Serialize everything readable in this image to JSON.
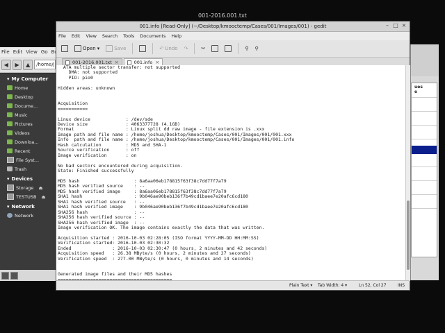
{
  "bg_window_title": "001-2016.001.txt",
  "file_manager": {
    "menu": [
      "File",
      "Edit",
      "View",
      "Go",
      "Book"
    ],
    "path_text": "/home/j",
    "sections": [
      {
        "title": "My Computer",
        "items": [
          {
            "label": "Home",
            "icon": "folder-icon"
          },
          {
            "label": "Desktop",
            "icon": "folder-icon"
          },
          {
            "label": "Docume...",
            "icon": "folder-icon"
          },
          {
            "label": "Music",
            "icon": "folder-icon"
          },
          {
            "label": "Pictures",
            "icon": "folder-icon"
          },
          {
            "label": "Videos",
            "icon": "folder-icon"
          },
          {
            "label": "Downloa...",
            "icon": "folder-icon"
          },
          {
            "label": "Recent",
            "icon": "folder-icon"
          },
          {
            "label": "File Syst...",
            "icon": "drive-icon"
          },
          {
            "label": "Trash",
            "icon": "trash-icon"
          }
        ]
      },
      {
        "title": "Devices",
        "items": [
          {
            "label": "Storage",
            "icon": "drive-icon"
          },
          {
            "label": "TESTUSB",
            "icon": "drive-icon"
          }
        ]
      },
      {
        "title": "Network",
        "items": [
          {
            "label": "Network",
            "icon": "network-icon"
          }
        ]
      }
    ]
  },
  "right_window": {
    "caption": "ues\ne"
  },
  "gedit": {
    "title": "001.info [Read-Only] (~/Desktop/kmooctemp/Cases/001/Images/001) - gedit",
    "menu": [
      "File",
      "Edit",
      "View",
      "Search",
      "Tools",
      "Documents",
      "Help"
    ],
    "toolbar": {
      "new": "",
      "open": "Open",
      "save": "Save",
      "print": "",
      "undo": "Undo",
      "redo": "",
      "cut": "",
      "copy": "",
      "paste": "",
      "find": "",
      "replace": ""
    },
    "tabs": [
      {
        "label": "001-2016.001.txt"
      },
      {
        "label": "001.info"
      }
    ],
    "content": "  ATA multiple sector transfer: not supported\n    DMA: not supported\n    PIO: pio0\n\nHidden areas: unknown\n\n\nAcquisition\n===========\n\nLinux device             : /dev/sde\nDevice size              : 4063377728 (4.1GB)\nFormat                   : Linux split dd raw image - file extension is .xxx\nImage path and file name : /home/joshua/Desktop/kmooctemp/Cases/001/Images/001/001.xxx\nInfo  path and file name : /home/joshua/Desktop/kmooctemp/Cases/001/Images/001/001.info\nHash calculation         : MD5 and SHA-1\nSource verification      : off\nImage verification       : on\n\nNo bad sectors encountered during acquisition.\nState: Finished successfully\n\nMD5 hash                    : 8a6aa06eb178815f63f38c7dd77f7a79\nMD5 hash verified source    : --\nMD5 hash verified image     : 8a6aa06eb178815f63f38c7dd77f7a79\nSHA1 hash                   : 9b046ae90beb136f7b49cd1baee7e20afc6cd180\nSHA1 hash verified source   : --\nSHA1 hash verified image    : 9b046ae90beb136f7b49cd1baee7e20afc6cd180\nSHA256 hash                 : --\nSHA256 hash verified source : --\nSHA256 hash verified image  : --\nImage verification OK. The image contains exactly the data that was written.\n\nAcquisition started : 2016-10-03 02:28:05 (ISO format YYYY-MM-DD HH:MM:SS)\nVerification started: 2016-10-03 02:30:32\nEnded               : 2016-10-03 02:30:47 (0 hours, 2 minutes and 42 seconds)\nAcquisition speed   : 26.38 MByte/s (0 hours, 2 minutes and 27 seconds)\nVerification speed  : 277.00 MByte/s (0 hours, 0 minutes and 14 seconds)\n\n\nGenerated image files and their MD5 hashes\n==========================================",
    "status": {
      "language": "Plain Text",
      "tab_width": "Tab Width: 4",
      "position": "Ln 52, Col 27",
      "mode": "INS"
    }
  }
}
